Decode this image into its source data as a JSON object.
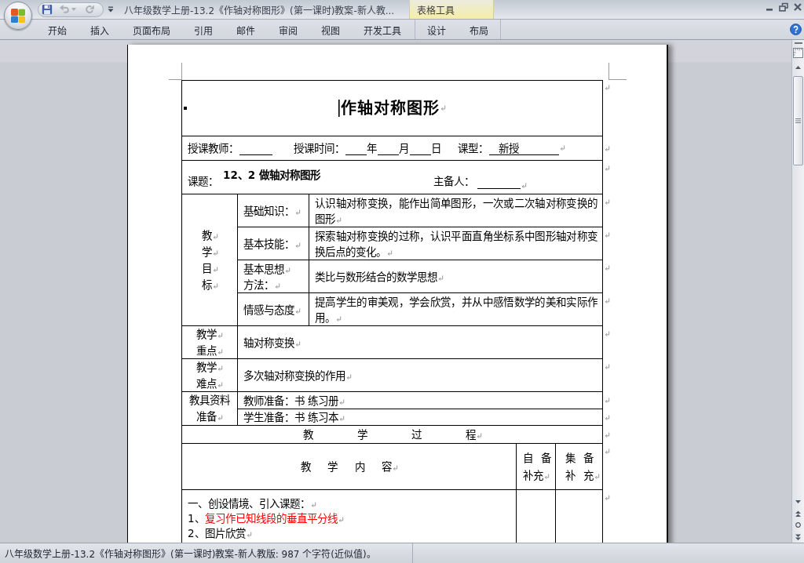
{
  "window": {
    "title": "八年级数学上册-13.2《作轴对称图形》(第一课时)教案-新人教...",
    "quick_access": [
      {
        "kind": "save",
        "disabled": false
      },
      {
        "kind": "undo",
        "disabled": true
      },
      {
        "kind": "redo",
        "disabled": true
      },
      {
        "kind": "customize",
        "disabled": false
      }
    ]
  },
  "ribbon": {
    "tabs": [
      {
        "label": "开始",
        "selected": false
      },
      {
        "label": "插入",
        "selected": false
      },
      {
        "label": "页面布局",
        "selected": false
      },
      {
        "label": "引用",
        "selected": false
      },
      {
        "label": "邮件",
        "selected": false
      },
      {
        "label": "审阅",
        "selected": false
      },
      {
        "label": "视图",
        "selected": false
      },
      {
        "label": "开发工具",
        "selected": false
      }
    ],
    "contextual_group": {
      "title": "表格工具",
      "tabs": [
        {
          "label": "设计",
          "selected": false
        },
        {
          "label": "布局",
          "selected": false
        }
      ]
    }
  },
  "document": {
    "show_marks": true,
    "title": {
      "text": "作轴对称图形",
      "caret": true
    },
    "info_line": [
      {
        "kind": "label",
        "text": "授课教师："
      },
      {
        "kind": "blank"
      },
      {
        "kind": "label",
        "text": "授课时间："
      },
      {
        "kind": "blank"
      },
      {
        "kind": "label",
        "text": "年"
      },
      {
        "kind": "blank"
      },
      {
        "kind": "label",
        "text": "月"
      },
      {
        "kind": "blank"
      },
      {
        "kind": "label",
        "text": "日"
      },
      {
        "kind": "label",
        "text": "课型："
      },
      {
        "kind": "blank",
        "value": "新授"
      }
    ],
    "topic": [
      {
        "kind": "label",
        "text": "课题："
      },
      {
        "kind": "heading",
        "text": "12、2 做轴对称图形"
      },
      {
        "kind": "label",
        "text": "主备人："
      },
      {
        "kind": "blank"
      }
    ],
    "objectives": {
      "header": [
        "教",
        "学",
        "目",
        "标"
      ],
      "items": [
        {
          "label": [
            "基础知识："
          ],
          "text": "认识轴对称变换，能作出简单图形，一次或二次轴对称变换的图形"
        },
        {
          "label": [
            "基本技能："
          ],
          "text": "探索轴对称变换的过称，认识平面直角坐标系中图形轴对称变换后点的变化。"
        },
        {
          "label": [
            "基本思想",
            "方法："
          ],
          "text": "类比与数形结合的数学思想"
        },
        {
          "label": [
            "情感与态度"
          ],
          "text": "提高学生的审美观，学会欣赏，并从中感悟数学的美和实际作用。"
        }
      ]
    },
    "key_points": [
      {
        "header": [
          "教学",
          "重点"
        ],
        "text": "轴对称变换"
      },
      {
        "header": [
          "教学",
          "难点"
        ],
        "text": "多次轴对称变换的作用"
      }
    ],
    "materials": {
      "header": "教具资料准备",
      "items": [
        "教师准备：书 练习册",
        "学生准备：书 练习本"
      ]
    },
    "process_heading": "教 学 过 程",
    "content_header": {
      "main": "教 学 内 容",
      "columns": [
        [
          "自 备",
          "补充"
        ],
        [
          "集 备",
          "补 充"
        ]
      ]
    },
    "content_lines": [
      {
        "segments": [
          {
            "text": "一、创设情境、引入课题：",
            "color": "#000000"
          }
        ]
      },
      {
        "segments": [
          {
            "text": "1、",
            "color": "#000000"
          },
          {
            "text": "复习作已知线段的垂直平分线",
            "color": "#ff0000"
          }
        ]
      },
      {
        "segments": [
          {
            "text": "2、图片欣赏",
            "color": "#000000"
          }
        ]
      }
    ]
  },
  "status_bar": {
    "text": "八年级数学上册-13.2《作轴对称图形》(第一课时)教案-新人教版: 987 个字符(近似值)。"
  }
}
